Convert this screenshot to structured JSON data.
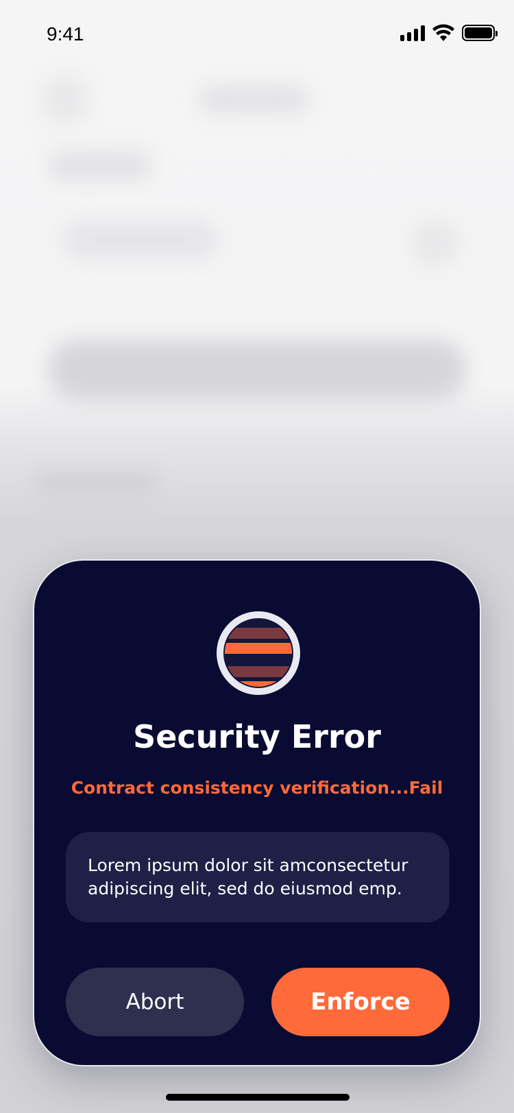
{
  "status_bar": {
    "time": "9:41",
    "icons": [
      "cellular-signal-icon",
      "wifi-icon",
      "battery-icon"
    ]
  },
  "modal": {
    "icon": "error-stripes-icon",
    "title": "Security Error",
    "status": "Contract consistency verification...Fail",
    "message": "Lorem ipsum dolor sit amconsectetur adipiscing elit, sed do eiusmod emp.",
    "buttons": {
      "abort_label": "Abort",
      "enforce_label": "Enforce"
    }
  },
  "colors": {
    "modal_background": "#090b32",
    "accent": "#ff6a3a",
    "message_background": "#1e2046",
    "secondary_button": "#2f3050"
  }
}
